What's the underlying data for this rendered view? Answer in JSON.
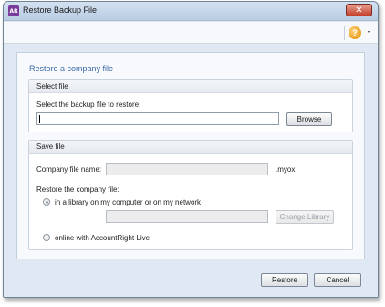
{
  "window": {
    "title": "Restore Backup File",
    "app_icon_text": "AR",
    "close_symbol": "✕"
  },
  "toolbar": {
    "help_symbol": "?",
    "dropdown_symbol": "▾"
  },
  "panel": {
    "title": "Restore a company file"
  },
  "select_file": {
    "header": "Select file",
    "prompt": "Select the backup file to restore:",
    "file_value": "",
    "browse_label": "Browse"
  },
  "save_file": {
    "header": "Save file",
    "company_name_label": "Company file name:",
    "company_name_value": "",
    "extension": ".myox",
    "restore_label": "Restore the company file:",
    "option_library": "in a library on my computer or on my network",
    "library_path_value": "",
    "change_library_label": "Change Library",
    "option_online": "online with AccountRight Live"
  },
  "footer": {
    "restore_label": "Restore",
    "cancel_label": "Cancel"
  }
}
